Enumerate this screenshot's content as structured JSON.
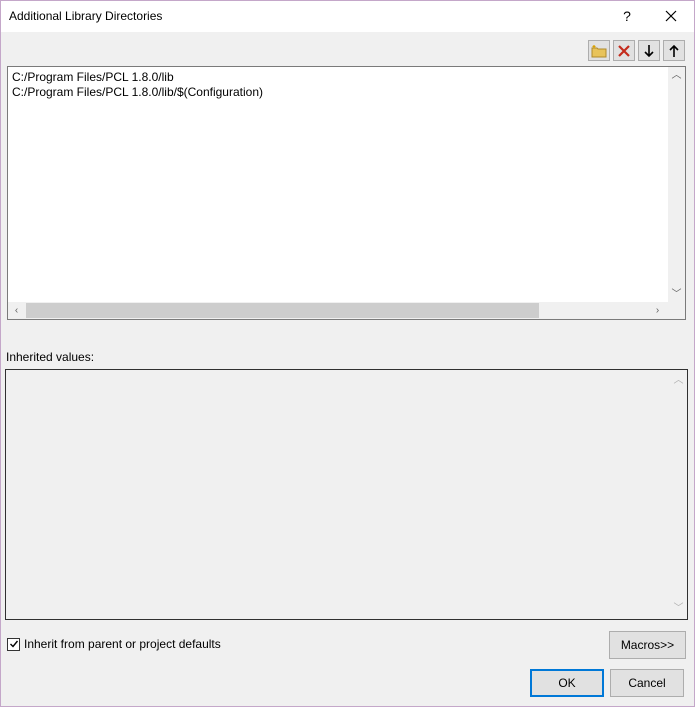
{
  "window": {
    "title": "Additional Library Directories",
    "help_label": "?",
    "close_label": "✕"
  },
  "toolbar": {
    "new_line_icon": "new-folder-icon",
    "delete_icon": "delete-icon",
    "move_down_icon": "arrow-down-icon",
    "move_up_icon": "arrow-up-icon",
    "delete_color": "#c42b1c"
  },
  "list": {
    "items": [
      "C:/Program Files/PCL 1.8.0/lib",
      "C:/Program Files/PCL 1.8.0/lib/$(Configuration)"
    ]
  },
  "inherited": {
    "label": "Inherited values:"
  },
  "inherit_checkbox": {
    "label": "Inherit from parent or project defaults",
    "checked": true
  },
  "buttons": {
    "macros": "Macros>>",
    "ok": "OK",
    "cancel": "Cancel"
  },
  "accent_color": "#0078d7"
}
